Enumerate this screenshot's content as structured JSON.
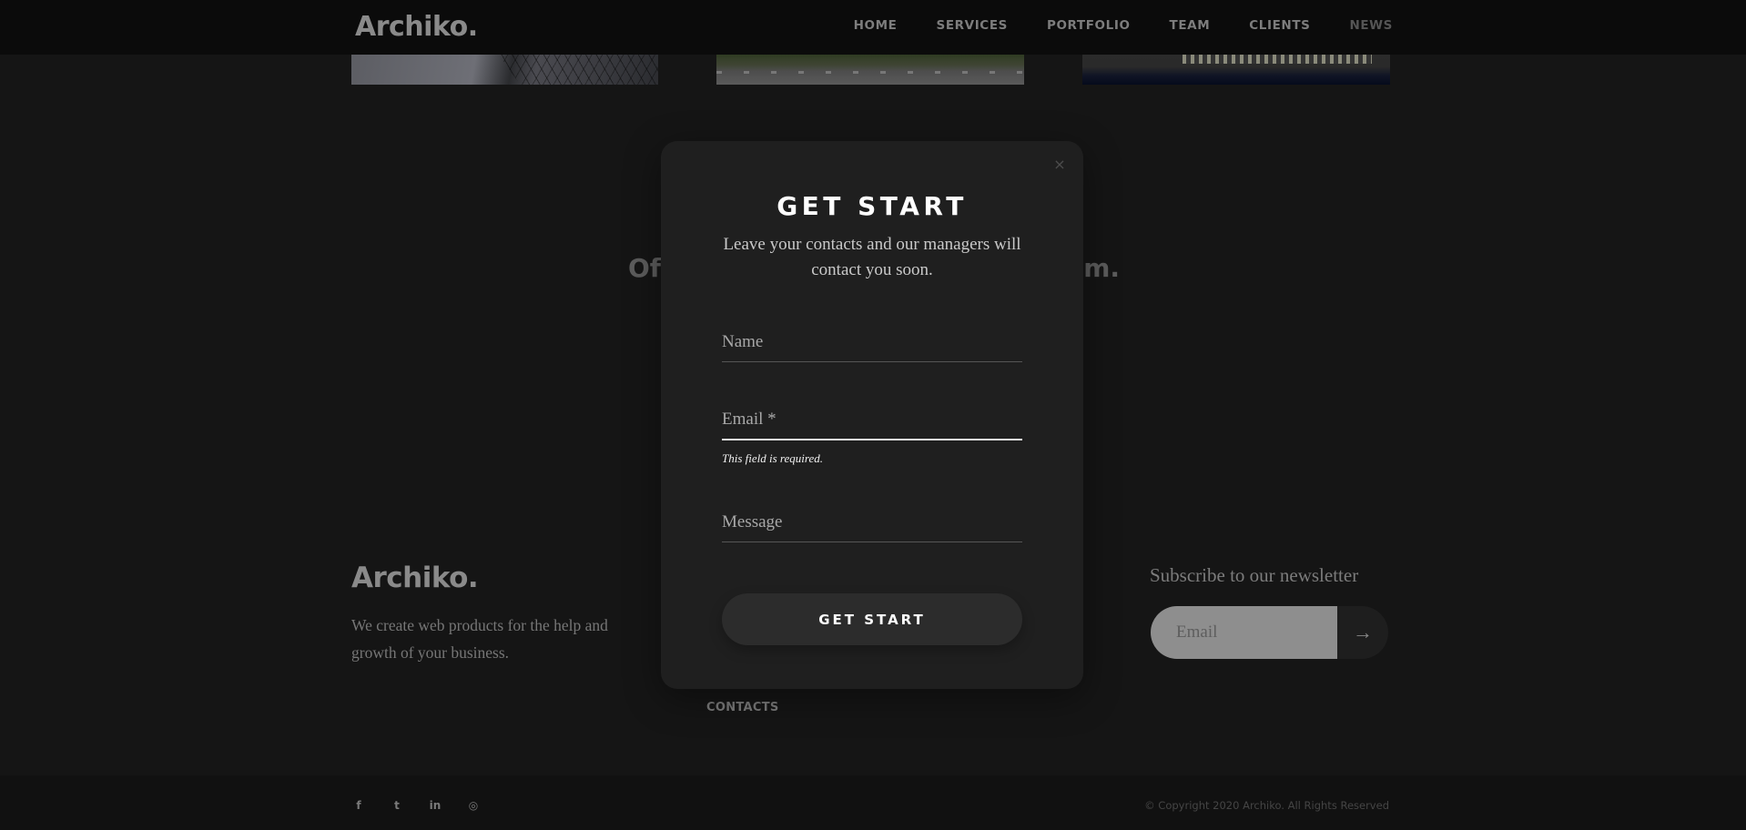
{
  "header": {
    "logo": "Archiko.",
    "nav": [
      "HOME",
      "SERVICES",
      "PORTFOLIO",
      "TEAM",
      "CLIENTS",
      "NEWS"
    ]
  },
  "background": {
    "heading_left": "Of",
    "heading_right": "m."
  },
  "modal": {
    "title": "GET START",
    "subtitle": "Leave your contacts and our managers will contact you soon.",
    "name_placeholder": "Name",
    "email_placeholder": "Email *",
    "email_error": "This field is required.",
    "message_placeholder": "Message",
    "submit_label": "GET START",
    "close_symbol": "×"
  },
  "footer": {
    "logo": "Archiko.",
    "text": "We create web products for the help and growth of your business.",
    "contacts_link": "CONTACTS",
    "newsletter_title": "Subscribe to our newsletter",
    "newsletter_placeholder": "Email",
    "newsletter_button": "→",
    "social": [
      {
        "icon": "facebook-icon",
        "glyph": "f"
      },
      {
        "icon": "twitter-icon",
        "glyph": "t"
      },
      {
        "icon": "linkedin-icon",
        "glyph": "in"
      },
      {
        "icon": "instagram-icon",
        "glyph": "◎"
      }
    ],
    "copyright": "© Copyright 2020 Archiko. All Rights Reserved"
  }
}
